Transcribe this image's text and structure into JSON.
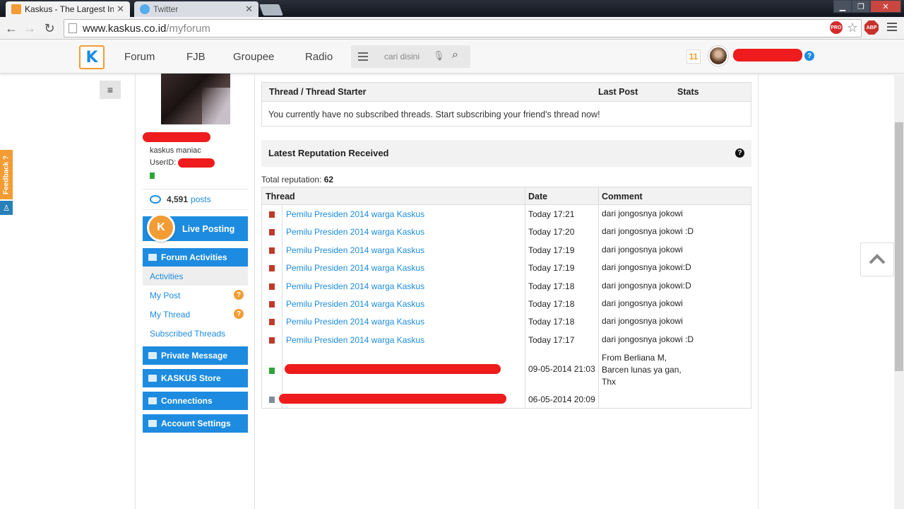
{
  "browser": {
    "tabs": [
      {
        "label": "Kaskus - The Largest Indo",
        "favicon_color": "#f39c34",
        "active": true
      },
      {
        "label": "Twitter",
        "favicon_color": "#55acee",
        "active": false
      }
    ],
    "url_host": "www.kaskus.co.id",
    "url_path": "/myforum",
    "extension_pro": "PRO",
    "extension_abp": "ABP"
  },
  "site": {
    "logo_text": "K",
    "nav": [
      "Forum",
      "FJB",
      "Groupee",
      "Radio"
    ],
    "search_placeholder": "cari disini",
    "notification_count": "11",
    "accent": "#1d8ce0",
    "orange": "#f39c34"
  },
  "sidebar": {
    "rank": "kaskus maniac",
    "userid_label": "UserID:",
    "posts_count": "4,591",
    "posts_label": "posts",
    "live_posting": "Live Posting",
    "forum_activities": "Forum Activities",
    "submenu": [
      "Activities",
      "My Post",
      "My Thread",
      "Subscribed Threads"
    ],
    "private_message": "Private Message",
    "kaskus_store": "KASKUS Store",
    "connections": "Connections",
    "account_settings": "Account Settings",
    "feedback": "Feedback ?"
  },
  "subscribed": {
    "columns": [
      "Thread / Thread Starter",
      "Last Post",
      "Stats"
    ],
    "empty_message": "You currently have no subscribed threads. Start subscribing your friend's thread now!"
  },
  "reputation": {
    "title": "Latest Reputation Received",
    "total_label": "Total reputation:",
    "total_value": "62",
    "columns": [
      "Thread",
      "Date",
      "Comment"
    ],
    "rows": [
      {
        "thread": "Pemilu Presiden 2014 warga Kaskus",
        "date": "Today 17:21",
        "comment": "dari jongosnya jokowi",
        "color": "#c0392b"
      },
      {
        "thread": "Pemilu Presiden 2014 warga Kaskus",
        "date": "Today 17:20",
        "comment": "dari jongosnya jokowi :D",
        "color": "#c0392b"
      },
      {
        "thread": "Pemilu Presiden 2014 warga Kaskus",
        "date": "Today 17:19",
        "comment": "dari jongosnya jokowi",
        "color": "#c0392b"
      },
      {
        "thread": "Pemilu Presiden 2014 warga Kaskus",
        "date": "Today 17:19",
        "comment": "dari jongosnya jokowi:D",
        "color": "#c0392b"
      },
      {
        "thread": "Pemilu Presiden 2014 warga Kaskus",
        "date": "Today 17:18",
        "comment": "dari jongosnya jokowi:D",
        "color": "#c0392b"
      },
      {
        "thread": "Pemilu Presiden 2014 warga Kaskus",
        "date": "Today 17:18",
        "comment": "dari jongosnya jokowi",
        "color": "#c0392b"
      },
      {
        "thread": "Pemilu Presiden 2014 warga Kaskus",
        "date": "Today 17:18",
        "comment": "dari jongosnya jokowi",
        "color": "#c0392b"
      },
      {
        "thread": "Pemilu Presiden 2014 warga Kaskus",
        "date": "Today 17:17",
        "comment": "dari jongosnya jokowi :D",
        "color": "#c0392b"
      }
    ],
    "row_positive": {
      "date": "09-05-2014 21:03",
      "comment_lines": [
        "From Berliana M,",
        "Barcen lunas ya gan,",
        "Thx"
      ],
      "color": "#2fa53a"
    },
    "row_neutral": {
      "date": "06-05-2014 20:09",
      "color": "#7f8c9a"
    }
  }
}
